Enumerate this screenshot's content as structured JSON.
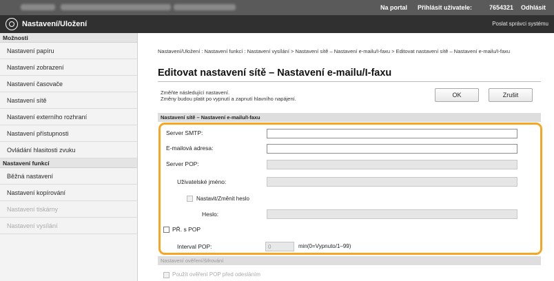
{
  "topbar": {
    "portal_link": "Na portal",
    "login_user_label": "Přihlásit uživatele:",
    "user_id": "7654321",
    "logout_link": "Odhlásit"
  },
  "header": {
    "title": "Nastavení/Uložení",
    "system_manager_link": "Poslat správci systému"
  },
  "sidebar": {
    "options_heading": "Možnosti",
    "items": [
      {
        "label": "Nastavení papíru"
      },
      {
        "label": "Nastavení zobrazení"
      },
      {
        "label": "Nastavení časovače"
      },
      {
        "label": "Nastavení sítě"
      },
      {
        "label": "Nastavení externího rozhraní"
      },
      {
        "label": "Nastavení přístupnosti"
      },
      {
        "label": "Ovládání hlasitosti zvuku"
      }
    ],
    "functions_heading": "Nastavení funkcí",
    "function_items": [
      {
        "label": "Běžná nastavení"
      },
      {
        "label": "Nastavení kopírování"
      },
      {
        "label": "Nastavení tiskárny"
      },
      {
        "label": "Nastavení vysílání"
      }
    ]
  },
  "main": {
    "breadcrumb": "Nastavení/Uložení : Nastavení funkcí : Nastavení vysílání > Nastavení sítě – Nastavení e-mailu/I-faxu > Editovat nastavení sítě – Nastavení e-mailu/I-faxu",
    "title": "Editovat nastavení sítě – Nastavení e-mailu/I-faxu",
    "note_line1": "Změňte následující nastavení.",
    "note_line2": "Změny budou platit po vypnutí a zapnutí hlavního napájení.",
    "ok_label": "OK",
    "cancel_label": "Zrušit",
    "section_title": "Nastavení sítě – Nastavení e-mailu/I-faxu",
    "smtp_label": "Server SMTP:",
    "smtp_value": "",
    "email_label": "E-mailová adresa:",
    "email_value": "",
    "pop_label": "Server POP:",
    "username_label": "Uživatelské jméno:",
    "set_password_label": "Nastavit/Změnit heslo",
    "password_label": "Heslo:",
    "rx_pop_label": "PŘ. s POP",
    "pop_interval_label": "Interval POP:",
    "pop_interval_value": "0",
    "pop_interval_unit": "min(0=Vypnuto/1–99)",
    "auth_section_title": "Nastavení ověření/šifrování",
    "pop_auth_label": "Použít ověření POP před odesláním"
  },
  "colors": {
    "highlight": "#f5a623",
    "titlebar": "#303030",
    "topbar": "#5a5a5a"
  }
}
